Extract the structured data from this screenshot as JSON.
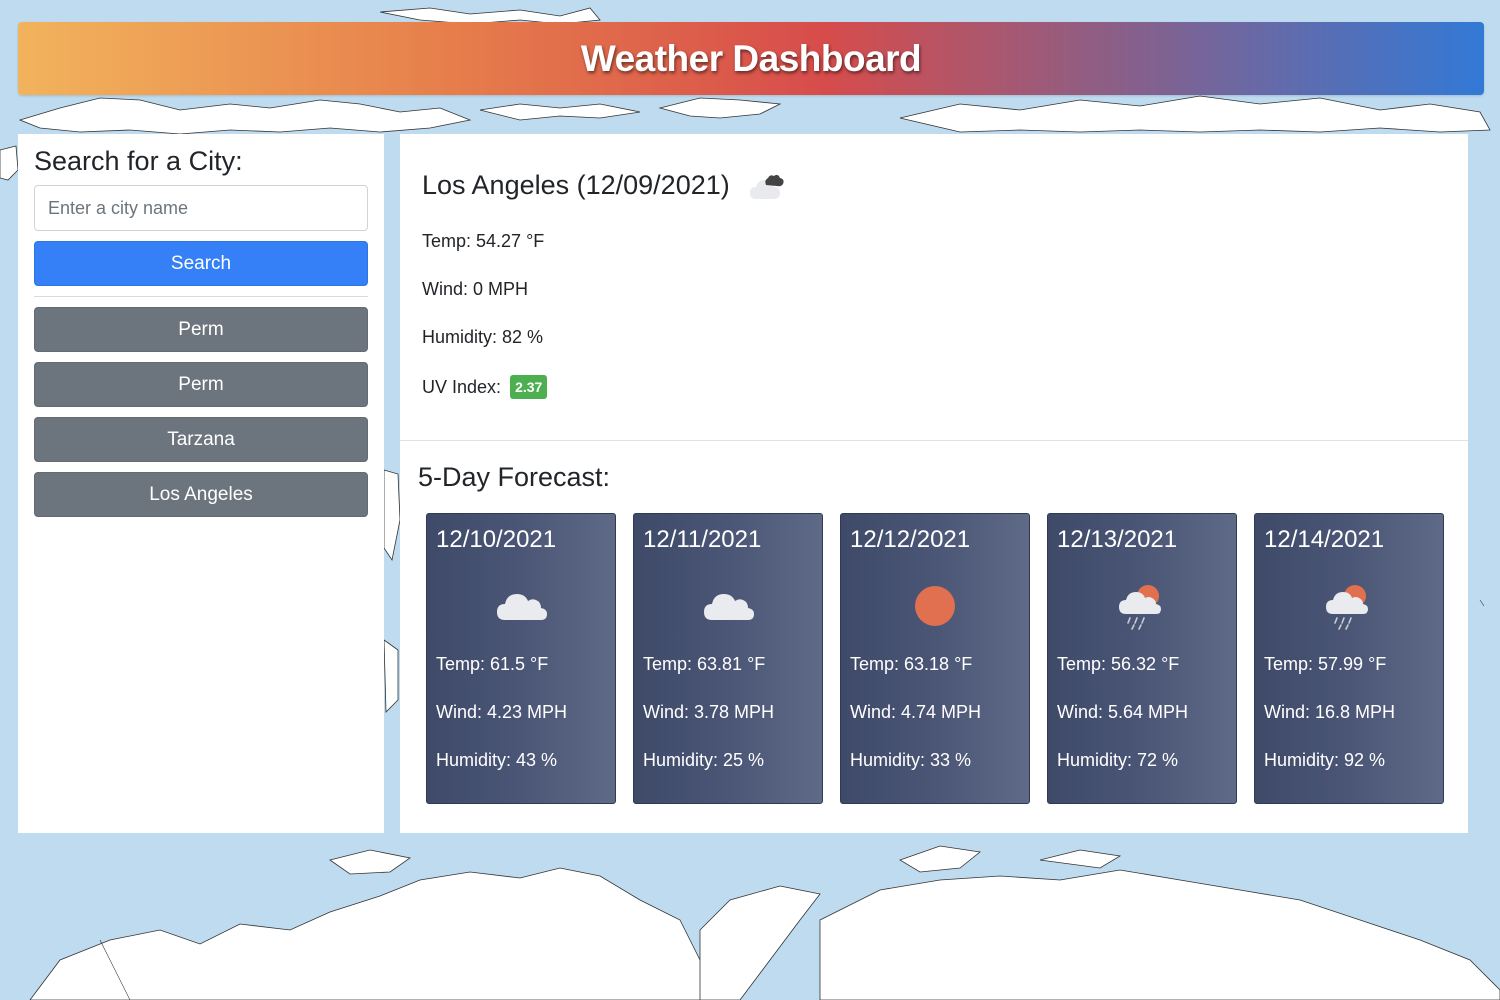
{
  "header": {
    "title": "Weather Dashboard"
  },
  "sidebar": {
    "heading": "Search for a City:",
    "input_placeholder": "Enter a city name",
    "input_value": "",
    "search_label": "Search",
    "history": [
      "Perm",
      "Perm",
      "Tarzana",
      "Los Angeles"
    ]
  },
  "current": {
    "title": "Los Angeles (12/09/2021)",
    "icon": "broken-clouds-icon",
    "temp": "Temp: 54.27 °F",
    "wind": "Wind: 0 MPH",
    "humidity": "Humidity: 82 %",
    "uv_label": "UV Index:",
    "uv_value": "2.37",
    "uv_color": "#4caf50"
  },
  "forecast": {
    "heading": "5-Day Forecast:",
    "days": [
      {
        "date": "12/10/2021",
        "icon": "cloud-icon",
        "temp": "Temp: 61.5 °F",
        "wind": "Wind: 4.23 MPH",
        "humidity": "Humidity: 43 %"
      },
      {
        "date": "12/11/2021",
        "icon": "cloud-icon",
        "temp": "Temp: 63.81 °F",
        "wind": "Wind: 3.78 MPH",
        "humidity": "Humidity: 25 %"
      },
      {
        "date": "12/12/2021",
        "icon": "sun-icon",
        "temp": "Temp: 63.18 °F",
        "wind": "Wind: 4.74 MPH",
        "humidity": "Humidity: 33 %"
      },
      {
        "date": "12/13/2021",
        "icon": "sun-rain-cloud-icon",
        "temp": "Temp: 56.32 °F",
        "wind": "Wind: 5.64 MPH",
        "humidity": "Humidity: 72 %"
      },
      {
        "date": "12/14/2021",
        "icon": "sun-rain-cloud-icon",
        "temp": "Temp: 57.99 °F",
        "wind": "Wind: 16.8 MPH",
        "humidity": "Humidity: 92 %"
      }
    ]
  },
  "colors": {
    "background": "#bedbf0",
    "search_button": "#3580f6",
    "history_button": "#6c757d",
    "card_dark": "#3e4a68",
    "sun": "#e07050"
  }
}
